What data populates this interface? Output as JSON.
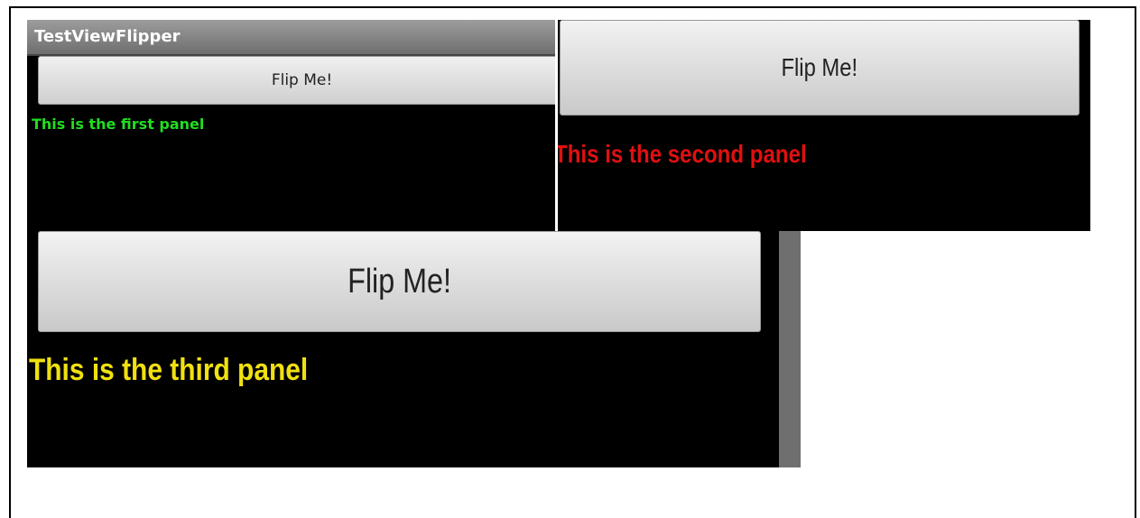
{
  "app": {
    "title": "TestViewFlipper"
  },
  "panels": [
    {
      "button_label": "Flip Me!",
      "text": "This is the first panel",
      "text_color": "#22dd22"
    },
    {
      "button_label": "Flip Me!",
      "text": "This is the second panel",
      "text_color": "#e01010"
    },
    {
      "button_label": "Flip Me!",
      "text": "This is the third panel",
      "text_color": "#f0e010"
    }
  ]
}
